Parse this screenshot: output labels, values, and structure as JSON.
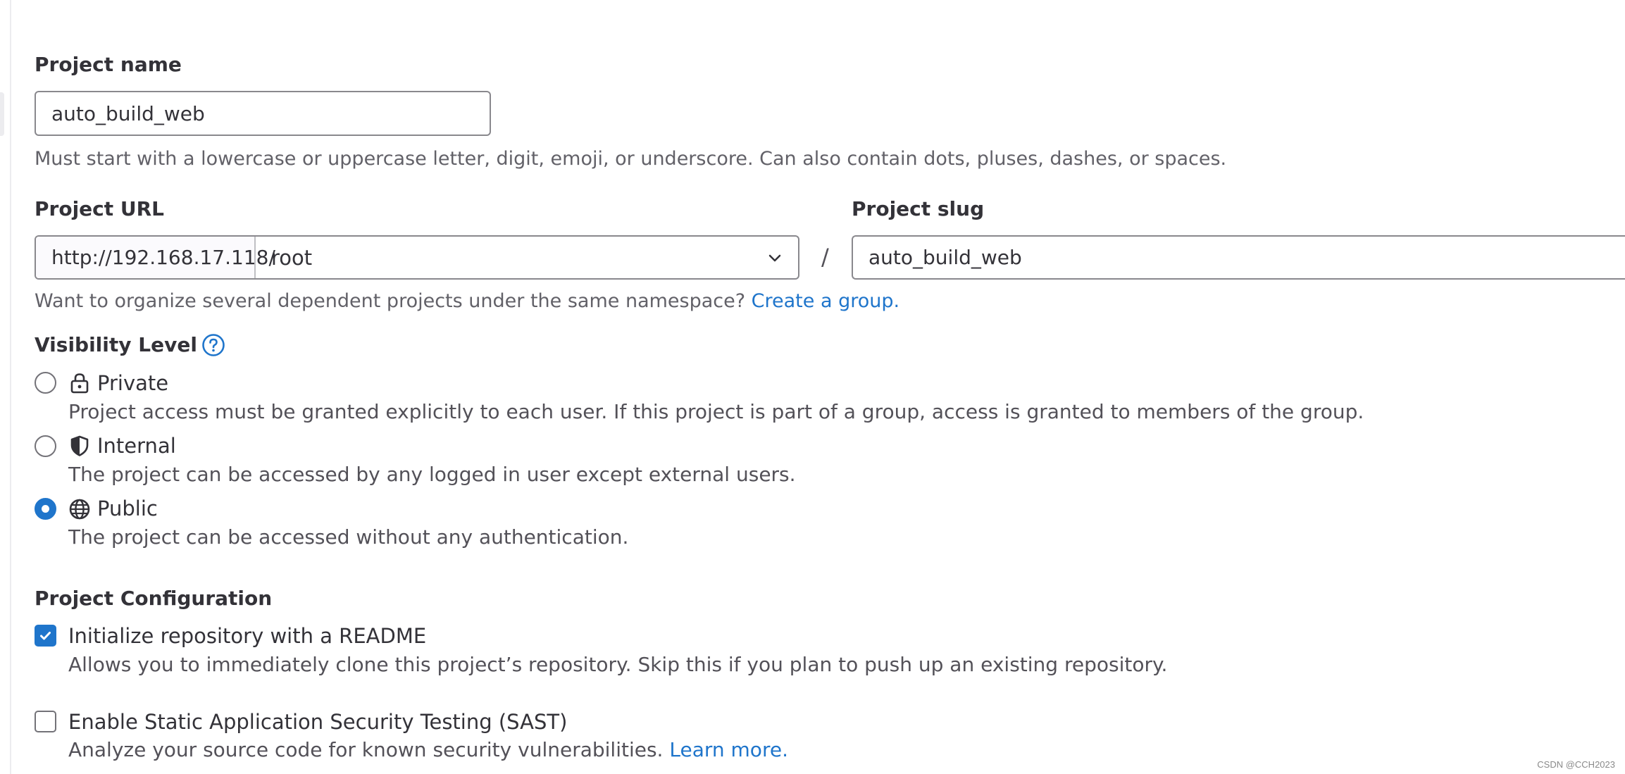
{
  "project_name": {
    "label": "Project name",
    "value": "auto_build_web",
    "help": "Must start with a lowercase or uppercase letter, digit, emoji, or underscore. Can also contain dots, pluses, dashes, or spaces."
  },
  "project_url": {
    "label": "Project URL",
    "prefix": "http://192.168.17.118/",
    "namespace": "root",
    "separator": "/"
  },
  "project_slug": {
    "label": "Project slug",
    "value": "auto_build_web"
  },
  "namespace_help": {
    "text": "Want to organize several dependent projects under the same namespace?",
    "link": "Create a group."
  },
  "visibility": {
    "label": "Visibility Level",
    "help_icon": "question-circle-icon",
    "selected": "Public",
    "options": [
      {
        "label": "Private",
        "icon": "lock-icon",
        "description": "Project access must be granted explicitly to each user. If this project is part of a group, access is granted to members of the group."
      },
      {
        "label": "Internal",
        "icon": "shield-icon",
        "description": "The project can be accessed by any logged in user except external users."
      },
      {
        "label": "Public",
        "icon": "globe-icon",
        "description": "The project can be accessed without any authentication."
      }
    ]
  },
  "configuration": {
    "label": "Project Configuration",
    "readme": {
      "label": "Initialize repository with a README",
      "description": "Allows you to immediately clone this project’s repository. Skip this if you plan to push up an existing repository.",
      "checked": true
    },
    "sast": {
      "label": "Enable Static Application Security Testing (SAST)",
      "description": "Analyze your source code for known security vulnerabilities.",
      "link": "Learn more.",
      "checked": false
    }
  },
  "watermark": "CSDN @CCH2023",
  "colors": {
    "accent": "#1f75cb",
    "text": "#333238",
    "muted": "#535158",
    "border": "#89888d"
  }
}
